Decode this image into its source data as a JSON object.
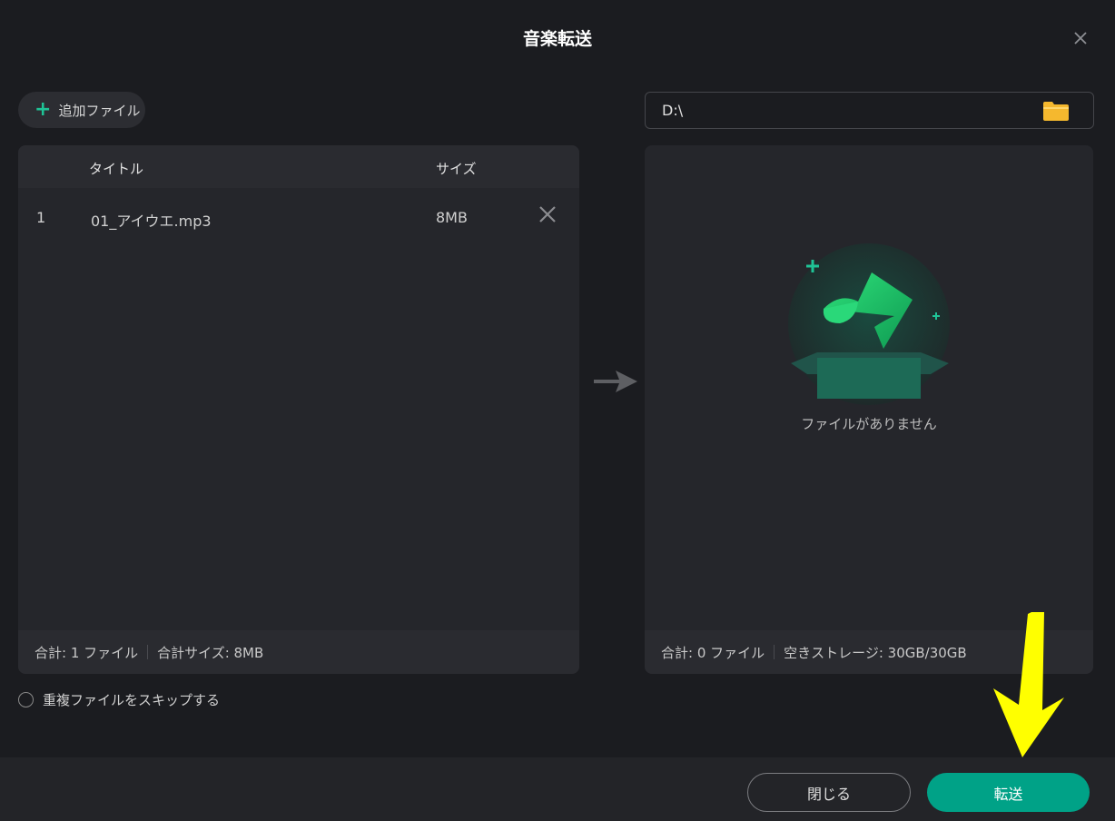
{
  "dialog": {
    "title": "音楽転送"
  },
  "source": {
    "add_label": "追加ファイル",
    "columns": {
      "title": "タイトル",
      "size": "サイズ"
    },
    "files": [
      {
        "index": "1",
        "name": "01_アイウエ.mp3",
        "size": "8MB"
      }
    ],
    "summary": {
      "count": "合計: 1 ファイル",
      "total_size": "合計サイズ: 8MB"
    }
  },
  "destination": {
    "path": "D:\\",
    "empty_text": "ファイルがありません",
    "summary": {
      "count": "合計: 0 ファイル",
      "storage": "空きストレージ: 30GB/30GB"
    }
  },
  "options": {
    "skip_duplicates_label": "重複ファイルをスキップする",
    "skip_duplicates_checked": false
  },
  "buttons": {
    "close_label": "閉じる",
    "transfer_label": "転送"
  },
  "colors": {
    "accent": "#00a287",
    "plus": "#1fc396",
    "folder": "#f5b82e",
    "annotation_arrow": "#ffff00"
  },
  "icons": {
    "close": "close-icon",
    "folder": "folder-icon",
    "delete": "delete-icon",
    "empty": "music-box-icon"
  }
}
